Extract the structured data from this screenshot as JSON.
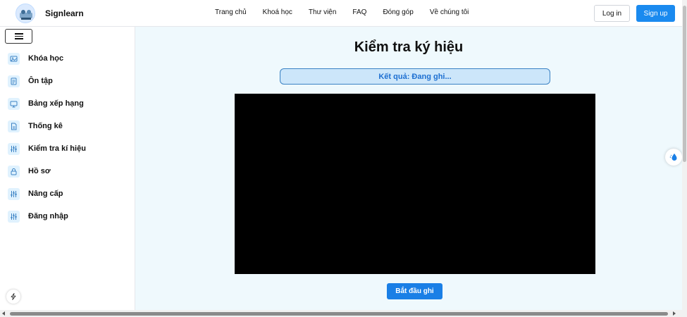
{
  "header": {
    "brand": "Signlearn",
    "nav": [
      "Trang chủ",
      "Khoá học",
      "Thư viện",
      "FAQ",
      "Đóng góp",
      "Về chúng tôi"
    ],
    "login_label": "Log in",
    "signup_label": "Sign up"
  },
  "sidebar": {
    "items": [
      {
        "label": "Khóa học",
        "icon": "image-icon"
      },
      {
        "label": "Ôn tập",
        "icon": "document-icon"
      },
      {
        "label": "Bảng xếp hạng",
        "icon": "monitor-icon"
      },
      {
        "label": "Thống kê",
        "icon": "file-icon"
      },
      {
        "label": "Kiểm tra kí hiệu",
        "icon": "sliders-icon"
      },
      {
        "label": "Hồ sơ",
        "icon": "lock-icon"
      },
      {
        "label": "Nâng cấp",
        "icon": "sliders-icon"
      },
      {
        "label": "Đăng nhập",
        "icon": "sliders-icon"
      }
    ]
  },
  "main": {
    "title": "Kiểm tra ký hiệu",
    "result_text": "Kết quả: Đang ghi...",
    "record_label": "Bắt đầu ghi"
  },
  "colors": {
    "accent": "#1a8aef",
    "main_bg": "#eff9fd",
    "result_bg": "#cce6fa",
    "icon_bg": "#e0f2fe"
  }
}
